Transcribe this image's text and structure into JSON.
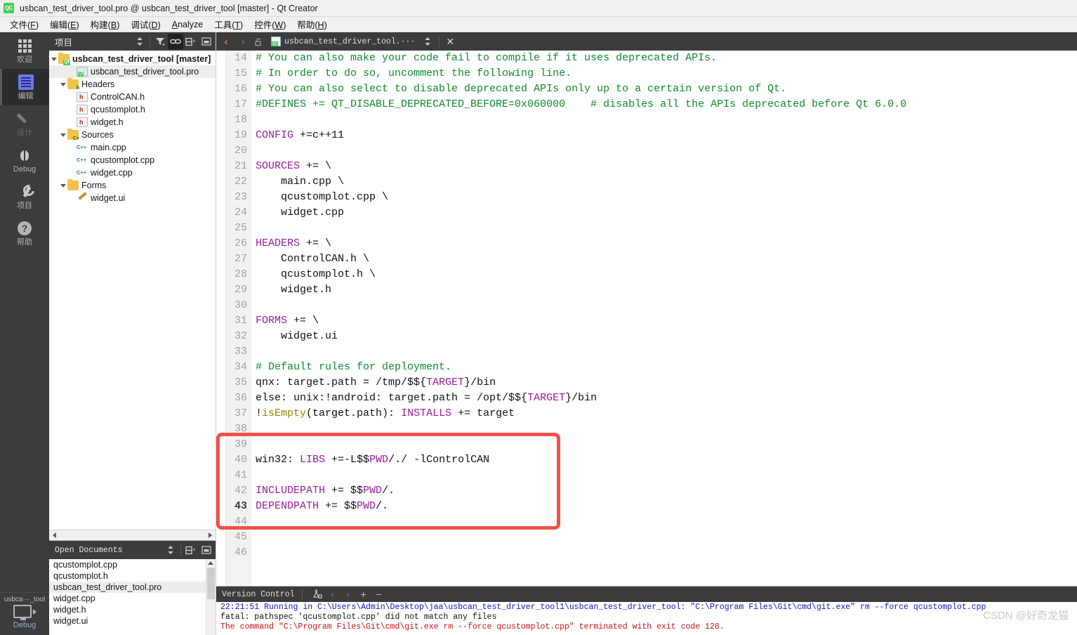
{
  "window": {
    "title": "usbcan_test_driver_tool.pro @ usbcan_test_driver_tool [master] - Qt Creator",
    "app_icon": "qt-creator-icon",
    "icon_text": "QC"
  },
  "menubar": {
    "items": [
      {
        "label": "文件(F)",
        "name": "menu-file"
      },
      {
        "label": "编辑(E)",
        "name": "menu-edit"
      },
      {
        "label": "构建(B)",
        "name": "menu-build"
      },
      {
        "label": "调试(D)",
        "name": "menu-debug"
      },
      {
        "label": "Analyze",
        "name": "menu-analyze"
      },
      {
        "label": "工具(T)",
        "name": "menu-tools"
      },
      {
        "label": "控件(W)",
        "name": "menu-window"
      },
      {
        "label": "帮助(H)",
        "name": "menu-help"
      }
    ]
  },
  "modebar": {
    "items": [
      {
        "label": "欢迎",
        "icon": "grid-icon",
        "state": "normal"
      },
      {
        "label": "编辑",
        "icon": "editor-icon",
        "state": "active"
      },
      {
        "label": "设计",
        "icon": "pencil-icon",
        "state": "disabled"
      },
      {
        "label": "Debug",
        "icon": "bug-icon",
        "state": "normal"
      },
      {
        "label": "项目",
        "icon": "wrench-icon",
        "state": "normal"
      },
      {
        "label": "帮助",
        "icon": "question-mark-icon",
        "state": "normal"
      }
    ],
    "kit": {
      "project": "usbca···_tool",
      "build_config": "Debug",
      "icon": "desktop-monitor-icon"
    }
  },
  "project_dock": {
    "title": "项目",
    "toolbar": [
      {
        "name": "sync-selection-icon",
        "glyph": "⇕"
      },
      {
        "name": "filter-icon",
        "glyph": "▼"
      },
      {
        "name": "link-with-editor-icon",
        "glyph": "⛓",
        "active": true
      },
      {
        "name": "split-icon",
        "glyph": "⊟+"
      },
      {
        "name": "close-dock-icon",
        "glyph": "⊡"
      }
    ],
    "tree": [
      {
        "label": "usbcan_test_driver_tool [master]",
        "depth": 0,
        "icon": "qt-project-folder-icon",
        "expanded": true,
        "bold": true,
        "selected": false
      },
      {
        "label": "usbcan_test_driver_tool.pro",
        "depth": 2,
        "icon": "qt-pro-file-icon",
        "expanded": false,
        "bold": false,
        "selected": true
      },
      {
        "label": "Headers",
        "depth": 1,
        "icon": "headers-folder-icon",
        "expanded": true,
        "bold": false,
        "selected": false
      },
      {
        "label": "ControlCAN.h",
        "depth": 2,
        "icon": "header-file-icon",
        "expanded": false,
        "bold": false,
        "selected": false
      },
      {
        "label": "qcustomplot.h",
        "depth": 2,
        "icon": "header-file-icon",
        "expanded": false,
        "bold": false,
        "selected": false
      },
      {
        "label": "widget.h",
        "depth": 2,
        "icon": "header-file-icon",
        "expanded": false,
        "bold": false,
        "selected": false
      },
      {
        "label": "Sources",
        "depth": 1,
        "icon": "sources-folder-icon",
        "expanded": true,
        "bold": false,
        "selected": false
      },
      {
        "label": "main.cpp",
        "depth": 2,
        "icon": "cpp-file-icon",
        "expanded": false,
        "bold": false,
        "selected": false
      },
      {
        "label": "qcustomplot.cpp",
        "depth": 2,
        "icon": "cpp-file-icon",
        "expanded": false,
        "bold": false,
        "selected": false
      },
      {
        "label": "widget.cpp",
        "depth": 2,
        "icon": "cpp-file-icon",
        "expanded": false,
        "bold": false,
        "selected": false
      },
      {
        "label": "Forms",
        "depth": 1,
        "icon": "forms-folder-icon",
        "expanded": true,
        "bold": false,
        "selected": false
      },
      {
        "label": "widget.ui",
        "depth": 2,
        "icon": "ui-file-icon",
        "expanded": false,
        "bold": false,
        "selected": false
      }
    ]
  },
  "open_documents": {
    "title": "Open Documents",
    "toolbar": [
      {
        "name": "sort-documents-icon",
        "glyph": "⇕"
      },
      {
        "name": "split-icon",
        "glyph": "⊟+"
      },
      {
        "name": "close-dock-icon",
        "glyph": "⊡"
      }
    ],
    "items": [
      {
        "label": "qcustomplot.cpp",
        "selected": false
      },
      {
        "label": "qcustomplot.h",
        "selected": false
      },
      {
        "label": "usbcan_test_driver_tool.pro",
        "selected": true
      },
      {
        "label": "widget.cpp",
        "selected": false
      },
      {
        "label": "widget.h",
        "selected": false
      },
      {
        "label": "widget.ui",
        "selected": false
      }
    ]
  },
  "editor": {
    "tabbar": {
      "back_icon": "chevron-left-icon",
      "forward_icon": "chevron-right-icon",
      "lock_icon": "unlocked-padlock-icon",
      "file_icon": "qt-pro-file-icon",
      "filename": "usbcan_test_driver_tool.···",
      "splitter_icon": "updown-arrows-icon",
      "close_icon": "✕"
    },
    "current_line": 43,
    "first_line": 14,
    "lines": [
      {
        "n": 14,
        "tokens": [
          {
            "t": "# You can also make your code fail to compile if it uses deprecated APIs.",
            "c": "c-comment"
          }
        ]
      },
      {
        "n": 15,
        "tokens": [
          {
            "t": "# In order to do so, uncomment the following line.",
            "c": "c-comment"
          }
        ]
      },
      {
        "n": 16,
        "tokens": [
          {
            "t": "# You can also select to disable deprecated APIs only up to a certain version of Qt.",
            "c": "c-comment"
          }
        ]
      },
      {
        "n": 17,
        "tokens": [
          {
            "t": "#DEFINES += QT_DISABLE_DEPRECATED_BEFORE=0x060000    # disables all the APIs deprecated before Qt 6.0.0",
            "c": "c-comment"
          }
        ]
      },
      {
        "n": 18,
        "tokens": []
      },
      {
        "n": 19,
        "tokens": [
          {
            "t": "CONFIG",
            "c": "c-var"
          },
          {
            "t": " +=c++11",
            "c": ""
          }
        ]
      },
      {
        "n": 20,
        "tokens": []
      },
      {
        "n": 21,
        "tokens": [
          {
            "t": "SOURCES",
            "c": "c-var"
          },
          {
            "t": " += \\",
            "c": ""
          }
        ]
      },
      {
        "n": 22,
        "tokens": [
          {
            "t": "    main.cpp \\",
            "c": ""
          }
        ]
      },
      {
        "n": 23,
        "tokens": [
          {
            "t": "    qcustomplot.cpp \\",
            "c": ""
          }
        ]
      },
      {
        "n": 24,
        "tokens": [
          {
            "t": "    widget.cpp",
            "c": ""
          }
        ]
      },
      {
        "n": 25,
        "tokens": []
      },
      {
        "n": 26,
        "tokens": [
          {
            "t": "HEADERS",
            "c": "c-var"
          },
          {
            "t": " += \\",
            "c": ""
          }
        ]
      },
      {
        "n": 27,
        "tokens": [
          {
            "t": "    ControlCAN.h \\",
            "c": ""
          }
        ]
      },
      {
        "n": 28,
        "tokens": [
          {
            "t": "    qcustomplot.h \\",
            "c": ""
          }
        ]
      },
      {
        "n": 29,
        "tokens": [
          {
            "t": "    widget.h",
            "c": ""
          }
        ]
      },
      {
        "n": 30,
        "tokens": []
      },
      {
        "n": 31,
        "tokens": [
          {
            "t": "FORMS",
            "c": "c-var"
          },
          {
            "t": " += \\",
            "c": ""
          }
        ]
      },
      {
        "n": 32,
        "tokens": [
          {
            "t": "    widget.ui",
            "c": ""
          }
        ]
      },
      {
        "n": 33,
        "tokens": []
      },
      {
        "n": 34,
        "tokens": [
          {
            "t": "# Default rules for deployment.",
            "c": "c-comment"
          }
        ]
      },
      {
        "n": 35,
        "tokens": [
          {
            "t": "qnx: target.path = /tmp/$${",
            "c": ""
          },
          {
            "t": "TARGET",
            "c": "c-var"
          },
          {
            "t": "}/bin",
            "c": ""
          }
        ]
      },
      {
        "n": 36,
        "tokens": [
          {
            "t": "else: unix:!android: target.path = /opt/$${",
            "c": ""
          },
          {
            "t": "TARGET",
            "c": "c-var"
          },
          {
            "t": "}/bin",
            "c": ""
          }
        ]
      },
      {
        "n": 37,
        "tokens": [
          {
            "t": "!",
            "c": ""
          },
          {
            "t": "isEmpty",
            "c": "c-func"
          },
          {
            "t": "(target.path): ",
            "c": ""
          },
          {
            "t": "INSTALLS",
            "c": "c-var"
          },
          {
            "t": " += target",
            "c": ""
          }
        ]
      },
      {
        "n": 38,
        "tokens": []
      },
      {
        "n": 39,
        "tokens": []
      },
      {
        "n": 40,
        "tokens": [
          {
            "t": "win32: ",
            "c": ""
          },
          {
            "t": "LIBS",
            "c": "c-var"
          },
          {
            "t": " +=-L$$",
            "c": ""
          },
          {
            "t": "PWD",
            "c": "c-var"
          },
          {
            "t": "/./ -lControlCAN",
            "c": ""
          }
        ]
      },
      {
        "n": 41,
        "tokens": []
      },
      {
        "n": 42,
        "tokens": [
          {
            "t": "INCLUDEPATH",
            "c": "c-var"
          },
          {
            "t": " += $$",
            "c": ""
          },
          {
            "t": "PWD",
            "c": "c-var"
          },
          {
            "t": "/.",
            "c": ""
          }
        ]
      },
      {
        "n": 43,
        "tokens": [
          {
            "t": "DEPENDPATH",
            "c": "c-var"
          },
          {
            "t": " += $$",
            "c": ""
          },
          {
            "t": "PWD",
            "c": "c-var"
          },
          {
            "t": "/.",
            "c": ""
          }
        ]
      },
      {
        "n": 44,
        "tokens": []
      },
      {
        "n": 45,
        "tokens": []
      },
      {
        "n": 46,
        "tokens": []
      }
    ],
    "annotation": {
      "name": "red-highlight-box",
      "color": "#f0514a",
      "covers_lines": "39-44"
    }
  },
  "output_pane": {
    "title": "Version Control",
    "toolbar": [
      {
        "name": "output-filter-icon",
        "glyph": "⚗"
      },
      {
        "name": "prev-icon",
        "glyph": "‹"
      },
      {
        "name": "next-icon",
        "glyph": "›"
      },
      {
        "name": "zoom-in-icon",
        "glyph": "+"
      },
      {
        "name": "zoom-out-icon",
        "glyph": "−"
      }
    ],
    "lines": [
      {
        "text": "22:21:51 Running in C:\\Users\\Admin\\Desktop\\jaa\\usbcan_test_driver_tool1\\usbcan_test_driver_tool: \"C:\\Program Files\\Git\\cmd\\git.exe\" rm --force qcustomplot.cpp",
        "color": "blue"
      },
      {
        "text": "fatal: pathspec 'qcustomplot.cpp' did not match any files",
        "color": "black"
      },
      {
        "text": "The command \"C:\\Program Files\\Git\\cmd\\git.exe rm --force qcustomplot.cpp\" terminated with exit code 128.",
        "color": "red"
      }
    ]
  },
  "watermark": {
    "text": "CSDN @好奇龙猫"
  }
}
